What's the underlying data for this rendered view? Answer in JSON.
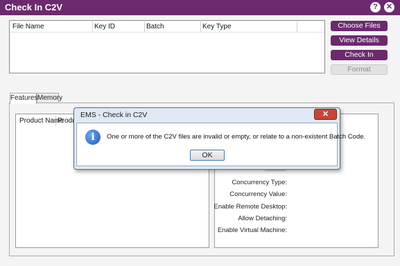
{
  "window": {
    "title": "Check In C2V",
    "help_icon": "question-icon",
    "close_icon": "close-icon"
  },
  "files_table": {
    "columns": [
      "File Name",
      "Key ID",
      "Batch",
      "Key Type"
    ]
  },
  "actions": {
    "choose_files": "Choose Files",
    "view_details": "View Details",
    "check_in": "Check In",
    "format": "Format"
  },
  "tabs": [
    {
      "label": "Features",
      "active": true
    },
    {
      "label": "Memory",
      "active": false
    }
  ],
  "features_table": {
    "columns": [
      "Product Name",
      "Produ"
    ]
  },
  "details": {
    "labels": [
      "Concurrency Type:",
      "Concurrency Value:",
      "Enable Remote Desktop:",
      "Allow Detaching:",
      "Enable Virtual Machine:"
    ]
  },
  "dialog": {
    "title": "EMS - Check in C2V",
    "message": "One or more of the C2V files are invalid or empty, or relate to a non-existent Batch Code.",
    "ok_label": "OK",
    "icon": "info-icon"
  },
  "colors": {
    "accent": "#6b2a6e",
    "dialog_frame": "#dfe9f5",
    "close_red": "#c8453a"
  }
}
